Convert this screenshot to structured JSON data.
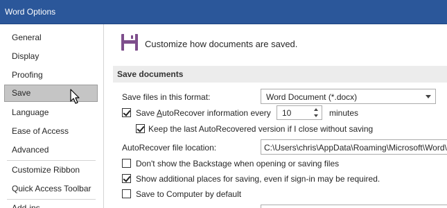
{
  "window": {
    "title": "Word Options"
  },
  "sidebar": {
    "items": [
      {
        "label": "General"
      },
      {
        "label": "Display"
      },
      {
        "label": "Proofing"
      },
      {
        "label": "Save",
        "selected": true
      },
      {
        "label": "Language"
      },
      {
        "label": "Ease of Access"
      },
      {
        "label": "Advanced"
      },
      {
        "label": "Customize Ribbon"
      },
      {
        "label": "Quick Access Toolbar"
      },
      {
        "label": "Add-ins"
      }
    ]
  },
  "header": {
    "text": "Customize how documents are saved.",
    "icon": "floppy-disk-icon"
  },
  "save_documents": {
    "section_title": "Save documents",
    "format_label": "Save files in this format:",
    "format_value": "Word Document (*.docx)",
    "autorecover_label_pre": "Save ",
    "autorecover_label_u": "A",
    "autorecover_label_post": "utoRecover information every",
    "autorecover_checked": true,
    "autorecover_minutes": "10",
    "minutes_label": "minutes",
    "keep_last_label": "Keep the last AutoRecovered version if I close without saving",
    "keep_last_checked": true,
    "location_label": "AutoRecover file location:",
    "location_value": "C:\\Users\\chris\\AppData\\Roaming\\Microsoft\\Word\\",
    "backstage_label": "Don't show the Backstage when opening or saving files",
    "backstage_checked": false,
    "additional_label": "Show additional places for saving, even if sign-in may be required.",
    "additional_checked": true,
    "computer_label": "Save to Computer by default",
    "computer_checked": false
  },
  "colors": {
    "titlebar": "#2b579a",
    "selected_item": "#c5c5c5",
    "section_bg": "#ececec"
  }
}
